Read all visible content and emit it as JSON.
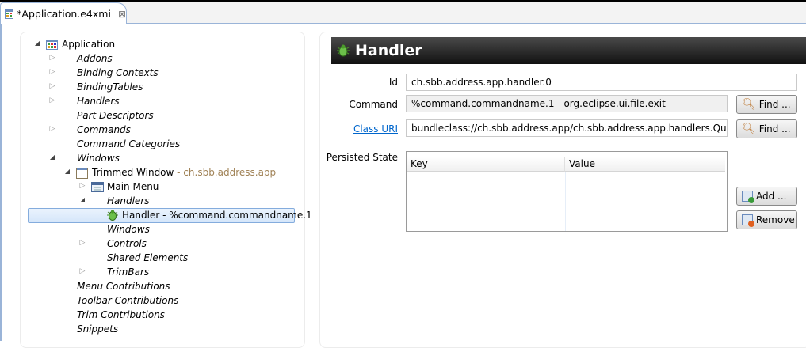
{
  "tab": {
    "title": "*Application.e4xmi",
    "icon": "application-model-icon",
    "close_icon": "close-icon"
  },
  "tree": [
    {
      "label": "Application",
      "italic": false,
      "arrow": "expanded",
      "level": 0,
      "icon": "application-model-icon"
    },
    {
      "label": "Addons",
      "italic": true,
      "arrow": "collapsed",
      "level": 1
    },
    {
      "label": "Binding Contexts",
      "italic": true,
      "arrow": "collapsed",
      "level": 1
    },
    {
      "label": "BindingTables",
      "italic": true,
      "arrow": "collapsed",
      "level": 1
    },
    {
      "label": "Handlers",
      "italic": true,
      "arrow": "collapsed",
      "level": 1
    },
    {
      "label": "Part Descriptors",
      "italic": true,
      "arrow": "none",
      "level": 1
    },
    {
      "label": "Commands",
      "italic": true,
      "arrow": "collapsed",
      "level": 1
    },
    {
      "label": "Command Categories",
      "italic": true,
      "arrow": "none",
      "level": 1
    },
    {
      "label": "Windows",
      "italic": true,
      "arrow": "expanded",
      "level": 1
    },
    {
      "label": "Trimmed Window",
      "sub": " - ch.sbb.address.app",
      "italic": false,
      "arrow": "expanded",
      "level": 2,
      "icon": "window-icon"
    },
    {
      "label": "Main Menu",
      "italic": false,
      "arrow": "collapsed",
      "level": 3,
      "icon": "menu-icon"
    },
    {
      "label": "Handlers",
      "italic": true,
      "arrow": "expanded",
      "level": 3
    },
    {
      "label": "Handler - %command.commandname.1",
      "italic": false,
      "arrow": "none",
      "level": 4,
      "icon": "bug-icon",
      "selected": true
    },
    {
      "label": "Windows",
      "italic": true,
      "arrow": "none",
      "level": 3
    },
    {
      "label": "Controls",
      "italic": true,
      "arrow": "collapsed",
      "level": 3
    },
    {
      "label": "Shared Elements",
      "italic": true,
      "arrow": "none",
      "level": 3
    },
    {
      "label": "TrimBars",
      "italic": true,
      "arrow": "collapsed",
      "level": 3
    },
    {
      "label": "Menu Contributions",
      "italic": true,
      "arrow": "none",
      "level": 1
    },
    {
      "label": "Toolbar Contributions",
      "italic": true,
      "arrow": "none",
      "level": 1
    },
    {
      "label": "Trim Contributions",
      "italic": true,
      "arrow": "none",
      "level": 1
    },
    {
      "label": "Snippets",
      "italic": true,
      "arrow": "none",
      "level": 1
    }
  ],
  "details": {
    "title": "Handler",
    "id_label": "Id",
    "id_value": "ch.sbb.address.app.handler.0",
    "command_label": "Command",
    "command_value": "%command.commandname.1 - org.eclipse.ui.file.exit",
    "class_label": "Class URI",
    "class_value": "bundleclass://ch.sbb.address.app/ch.sbb.address.app.handlers.QuitHandler",
    "find_label": "Find ...",
    "persisted_label": "Persisted State",
    "columns": [
      "Key",
      "Value"
    ],
    "add_label": "Add ...",
    "remove_label": "Remove"
  }
}
